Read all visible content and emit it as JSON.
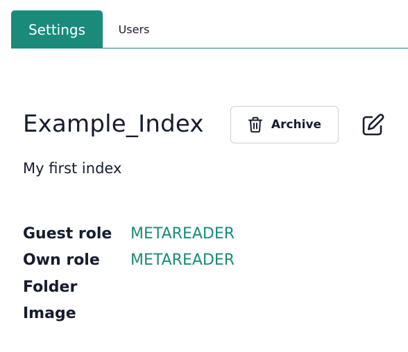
{
  "tabs": {
    "settings": "Settings",
    "users": "Users"
  },
  "header": {
    "title": "Example_Index",
    "archive_label": "Archive"
  },
  "description": "My first index",
  "properties": [
    {
      "key": "Guest role",
      "value": "METAREADER"
    },
    {
      "key": "Own role",
      "value": "METAREADER"
    },
    {
      "key": "Folder",
      "value": ""
    },
    {
      "key": "Image",
      "value": ""
    }
  ],
  "icons": {
    "archive": "trash-icon",
    "edit": "edit-icon"
  },
  "colors": {
    "accent": "#1a8a7a",
    "text": "#161c2d",
    "button_border": "#c9d1d9"
  }
}
